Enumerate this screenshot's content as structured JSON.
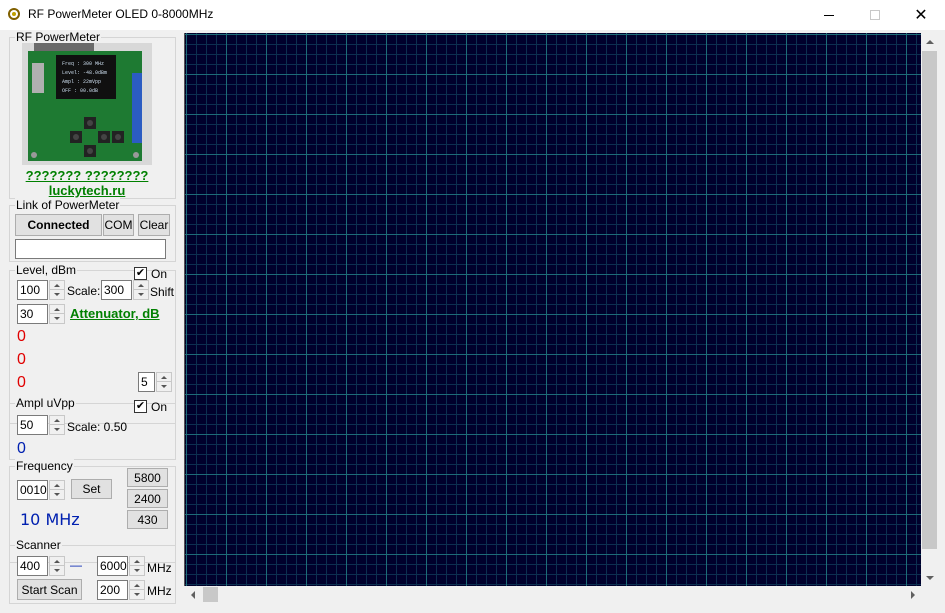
{
  "window": {
    "title": "RF PowerMeter OLED 0-8000MHz",
    "close_glyph": "✕"
  },
  "device_group": {
    "legend": "RF PowerMeter",
    "caption": "??????? ????????",
    "site": "luckytech.ru",
    "oled": {
      "line1": "Freq  :  300 MHz",
      "line2": "Level : -48.0dBm",
      "line3": "Ampl  : 22mVpp",
      "line4": "OFFset: 00.0dB"
    }
  },
  "link_group": {
    "legend": "Link of PowerMeter",
    "connected_label": "Connected",
    "com_label": "COM",
    "clear_label": "Clear",
    "status_value": ""
  },
  "level_group": {
    "legend": "Level, dBm",
    "on_label": "On",
    "on_checked": true,
    "level_value": "100",
    "scale_label": "Scale:",
    "scale_value": "300",
    "shift_label": "Shift",
    "atten_value": "30",
    "atten_link": "Attenuator, dB",
    "readings": [
      "0",
      "0",
      "0"
    ],
    "avg_value": "5"
  },
  "ampl_group": {
    "legend": "Ampl uVpp",
    "on_label": "On",
    "on_checked": true,
    "value": "50",
    "scale_label": "Scale: 0.50",
    "reading": "0"
  },
  "freq_group": {
    "legend": "Frequency",
    "value": "0010",
    "set_label": "Set",
    "reading": "10 MHz",
    "presets": [
      "5800",
      "2400",
      "430"
    ]
  },
  "scanner_group": {
    "legend": "Scanner",
    "start_value": "400",
    "dash": "—",
    "end_value": "6000",
    "mhz1": "MHz",
    "start_scan_label": "Start Scan",
    "step_value": "200",
    "mhz2": "MHz"
  },
  "colors": {
    "plot_background": "#00002c",
    "grid_major": "#1d6b78",
    "grid_minor": "#0c2f50",
    "link_green": "#008000",
    "reading_red": "#e00000",
    "reading_blue": "#0020b0"
  }
}
